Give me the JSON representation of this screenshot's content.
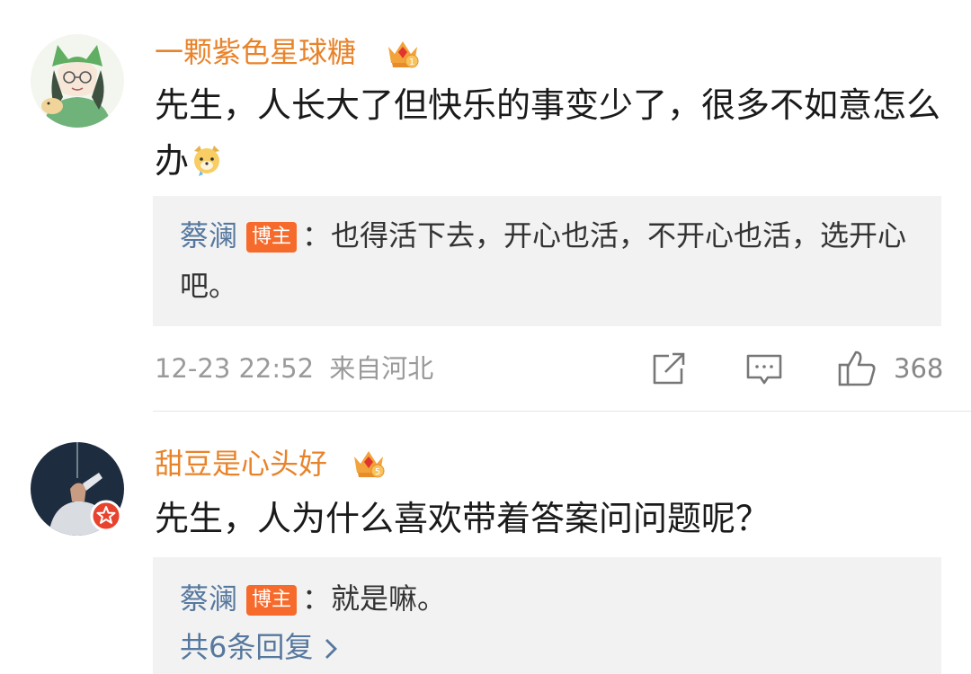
{
  "comments": [
    {
      "username": "一颗紫色星球糖",
      "crown_level": "1",
      "text": "先生，人长大了但快乐的事变少了，很多不如意怎么办",
      "emoji": "dog-emoji",
      "reply": {
        "author": "蔡澜",
        "badge": "博主",
        "colon": "：",
        "text": "也得活下去，开心也活，不开心也活，选开心吧。"
      },
      "time": "12-23 22:52",
      "location": "来自河北",
      "likes": "368",
      "icons": [
        "share-icon",
        "comment-icon",
        "like-icon"
      ]
    },
    {
      "username": "甜豆是心头好",
      "crown_level": "5",
      "text": "先生，人为什么喜欢带着答案问问题呢？",
      "reply": {
        "author": "蔡澜",
        "badge": "博主",
        "colon": "：",
        "text": "就是嘛。"
      },
      "more_replies": "共6条回复"
    }
  ],
  "colors": {
    "username": "#e8832a",
    "reply_author": "#56789e",
    "badge_bg": "#f66a2b",
    "reply_bg": "#f2f2f2",
    "meta_text": "#9a9a9a"
  }
}
